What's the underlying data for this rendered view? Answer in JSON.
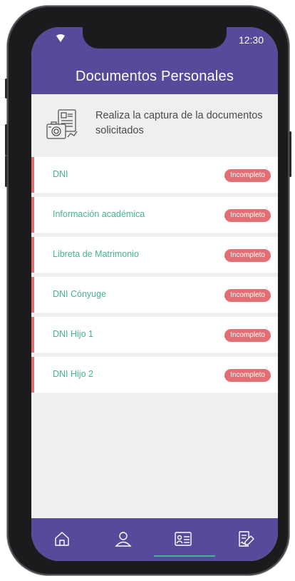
{
  "status_bar": {
    "time": "12:30"
  },
  "header": {
    "title": "Documentos Personales"
  },
  "intro": {
    "text": "Realiza la captura de la documentos solicitados",
    "icon": "id-camera-icon"
  },
  "documents": [
    {
      "label": "DNI",
      "status": "Incompleto"
    },
    {
      "label": "Información académica",
      "status": "Incompleto"
    },
    {
      "label": "Libreta de Matrimonio",
      "status": "Incompleto"
    },
    {
      "label": "DNI Cónyuge",
      "status": "Incompleto"
    },
    {
      "label": "DNI Hijo 1",
      "status": "Incompleto"
    },
    {
      "label": "DNI Hijo 2",
      "status": "Incompleto"
    }
  ],
  "tabbar": {
    "items": [
      {
        "icon": "home-icon"
      },
      {
        "icon": "user-icon"
      },
      {
        "icon": "id-card-icon",
        "active": true
      },
      {
        "icon": "signature-document-icon"
      }
    ]
  },
  "colors": {
    "header": "#554b9a",
    "accent_green": "#3fb68f",
    "badge_red": "#e26f74",
    "background": "#efefef"
  }
}
